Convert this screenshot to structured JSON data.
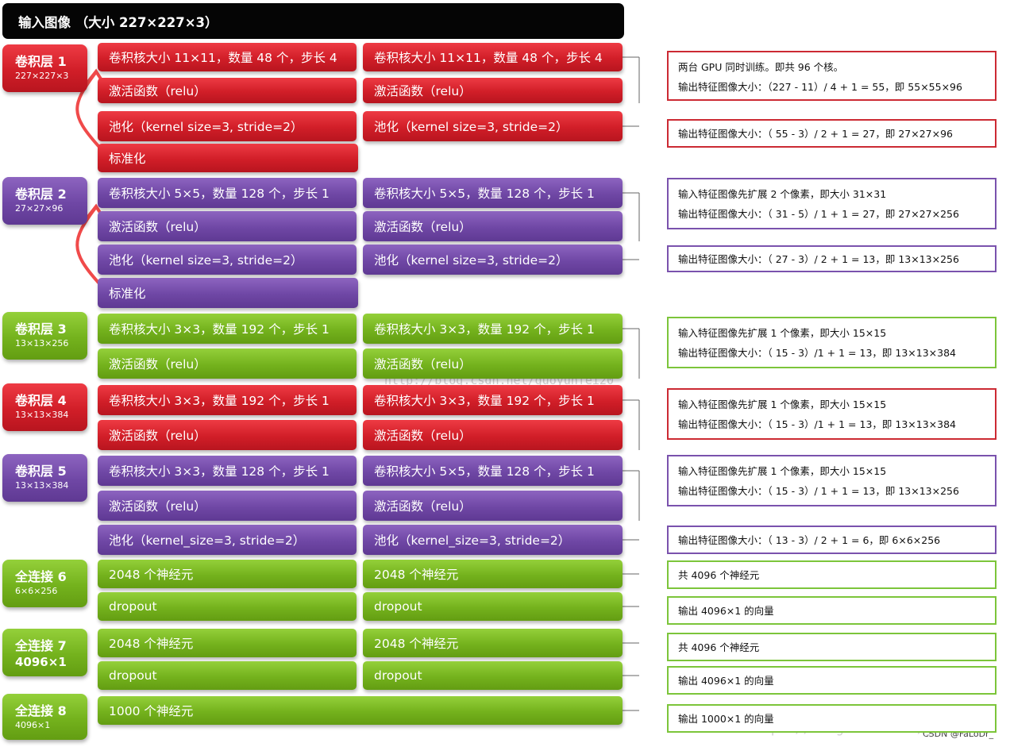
{
  "header": {
    "title": "输入图像 （大小 227×227×3）"
  },
  "layers": [
    {
      "id": "conv1",
      "name": "卷积层 1",
      "dims": "227×227×3",
      "color": "red",
      "rows": [
        [
          "卷积核大小 11×11，数量 48 个，步长 4",
          "卷积核大小 11×11，数量 48 个，步长 4"
        ],
        [
          "激活函数（relu）",
          "激活函数（relu）"
        ],
        [
          "池化（kernel  size=3, stride=2）",
          "池化（kernel  size=3, stride=2）"
        ],
        [
          "标准化"
        ]
      ],
      "notes": [
        [
          "两台 GPU 同时训练。即共 96 个核。",
          "输出特征图像大小：（227 - 11）/ 4 + 1 = 55，即 55×55×96"
        ],
        [
          "输出特征图像大小：（   55 - 3）/ 2 + 1 = 27，即 27×27×96"
        ]
      ]
    },
    {
      "id": "conv2",
      "name": "卷积层 2",
      "dims": "27×27×96",
      "color": "purple",
      "rows": [
        [
          "卷积核大小 5×5，数量 128 个，步长 1",
          "卷积核大小 5×5，数量 128 个，步长 1"
        ],
        [
          "激活函数（relu）",
          "激活函数（relu）"
        ],
        [
          "池化（kernel  size=3, stride=2）",
          "池化（kernel  size=3, stride=2）"
        ],
        [
          "标准化"
        ]
      ],
      "notes": [
        [
          "输入特征图像先扩展 2 个像素，即大小 31×31",
          "输出特征图像大小：（   31 - 5）/ 1 + 1 = 27，即 27×27×256"
        ],
        [
          "输出特征图像大小：（   27 - 3）/ 2 + 1 = 13，即 13×13×256"
        ]
      ]
    },
    {
      "id": "conv3",
      "name": "卷积层 3",
      "dims": "13×13×256",
      "color": "green",
      "rows": [
        [
          "卷积核大小 3×3，数量 192 个，步长 1",
          "卷积核大小 3×3，数量 192 个，步长 1"
        ],
        [
          "激活函数（relu）",
          "激活函数（relu）"
        ]
      ],
      "notes": [
        [
          "输入特征图像先扩展 1 个像素，即大小 15×15",
          "输出特征图像大小：（   15 - 3）/1 + 1 = 13，即 13×13×384"
        ]
      ]
    },
    {
      "id": "conv4",
      "name": "卷积层 4",
      "dims": "13×13×384",
      "color": "red",
      "rows": [
        [
          "卷积核大小 3×3，数量 192 个，步长 1",
          "卷积核大小 3×3，数量 192 个，步长 1"
        ],
        [
          "激活函数（relu）",
          "激活函数（relu）"
        ]
      ],
      "notes": [
        [
          "输入特征图像先扩展 1 个像素，即大小 15×15",
          "输出特征图像大小：（   15 - 3）/1 + 1 = 13，即 13×13×384"
        ]
      ]
    },
    {
      "id": "conv5",
      "name": "卷积层 5",
      "dims": "13×13×384",
      "color": "purple",
      "rows": [
        [
          "卷积核大小 3×3，数量 128 个，步长 1",
          "卷积核大小 5×5，数量 128 个，步长 1"
        ],
        [
          "激活函数（relu）",
          "激活函数（relu）"
        ],
        [
          "池化（kernel_size=3, stride=2）",
          "池化（kernel_size=3, stride=2）"
        ]
      ],
      "notes": [
        [
          "输入特征图像先扩展 1 个像素，即大小 15×15",
          "输出特征图像大小：（   15 - 3）/ 1 + 1 = 13，即 13×13×256"
        ],
        [
          "输出特征图像大小：（   13 - 3）/ 2 + 1 = 6，即 6×6×256"
        ]
      ]
    },
    {
      "id": "fc6",
      "name": "全连接 6",
      "dims": "6×6×256",
      "color": "green",
      "rows": [
        [
          "2048 个神经元",
          "2048 个神经元"
        ],
        [
          "dropout",
          "dropout"
        ]
      ],
      "notes": [
        [
          "共 4096 个神经元"
        ],
        [
          "输出 4096×1 的向量"
        ]
      ]
    },
    {
      "id": "fc7",
      "name": "全连接 7",
      "dims": "4096×1",
      "color": "green",
      "rows": [
        [
          "2048 个神经元",
          "2048 个神经元"
        ],
        [
          "dropout",
          "dropout"
        ]
      ],
      "notes": [
        [
          "共 4096 个神经元"
        ],
        [
          "输出 4096×1 的向量"
        ]
      ]
    },
    {
      "id": "fc8",
      "name": "全连接 8",
      "dims": "4096×1",
      "color": "green",
      "rows": [
        [
          "1000 个神经元"
        ]
      ],
      "notes": [
        [
          "输出 1000×1 的向量"
        ]
      ]
    }
  ],
  "watermarks": {
    "center": "http://blog.csdn.net/guoyunfei20",
    "bottom": "https://blog.csdn.net/jianeman"
  },
  "credit": "CSDN @FaLoDr_",
  "colors": {
    "red": "#d11e28",
    "purple": "#6f47a5",
    "green": "#74b21d",
    "arrow": "#f04a4a",
    "connector": "#666666"
  }
}
